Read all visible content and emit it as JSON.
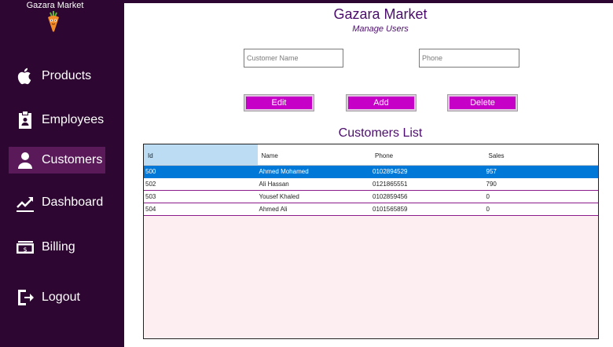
{
  "sidebar": {
    "app_name": "Gazara Market",
    "items": [
      {
        "label": "Products",
        "icon": "apple-icon"
      },
      {
        "label": "Employees",
        "icon": "id-badge-icon"
      },
      {
        "label": "Customers",
        "icon": "user-icon",
        "active": true
      },
      {
        "label": "Dashboard",
        "icon": "trend-chart-icon"
      },
      {
        "label": "Billing",
        "icon": "money-bill-icon"
      },
      {
        "label": "Logout",
        "icon": "logout-icon"
      }
    ]
  },
  "header": {
    "title": "Gazara Market",
    "subtitle": "Manage Users"
  },
  "form": {
    "customer_name_placeholder": "Customer Name",
    "phone_placeholder": "Phone"
  },
  "buttons": {
    "edit": "Edit",
    "add": "Add",
    "delete": "Delete"
  },
  "customers_list": {
    "title": "Customers List",
    "columns": [
      "Id",
      "Name",
      "Phone",
      "Sales"
    ],
    "rows": [
      [
        "500",
        "Ahmed Mohamed",
        "0102894529",
        "957"
      ],
      [
        "502",
        "Ali Hassan",
        "0121865551",
        "790"
      ],
      [
        "503",
        "Yousef Khaled",
        "0102859456",
        "0"
      ],
      [
        "504",
        "Ahmed Ali",
        "0101565859",
        "0"
      ]
    ]
  },
  "colors": {
    "sidebar_bg": "#2d0631",
    "active_item": "#5a1a5a",
    "accent_button": "#c700c7",
    "title_text": "#4b0d6b",
    "row_selected": "#0078d7",
    "grid_bg": "#fdeef2"
  }
}
